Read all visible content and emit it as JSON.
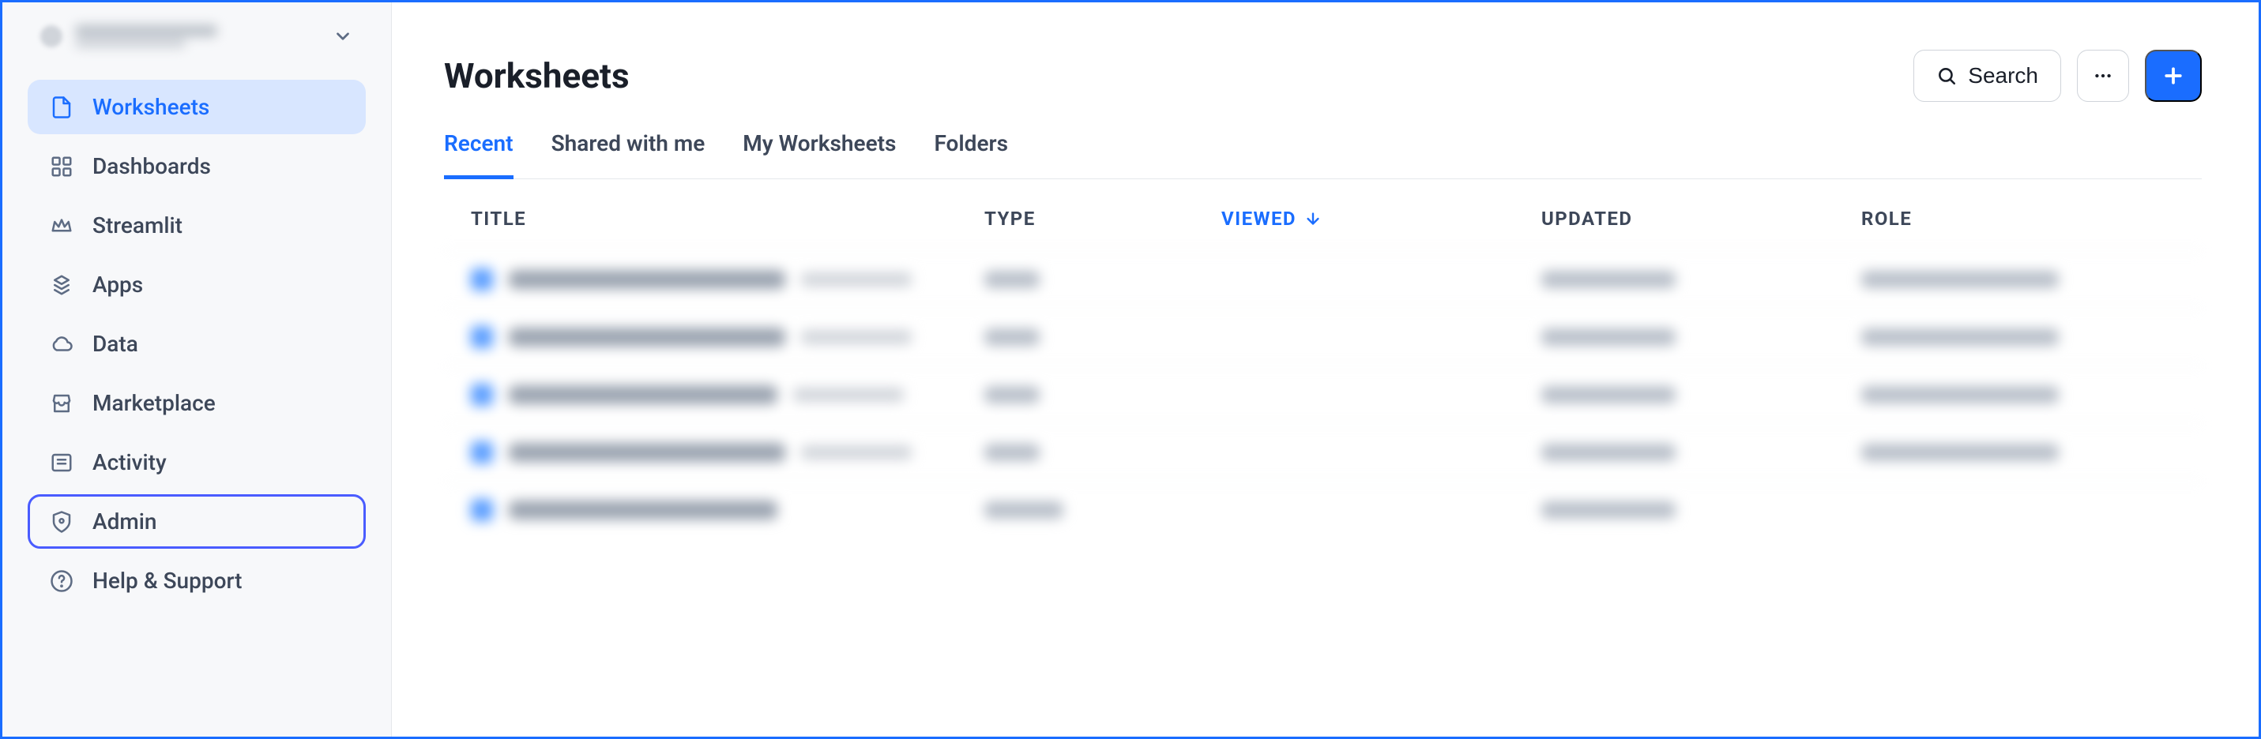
{
  "sidebar": {
    "nav": [
      {
        "label": "Worksheets",
        "icon": "document"
      },
      {
        "label": "Dashboards",
        "icon": "grid"
      },
      {
        "label": "Streamlit",
        "icon": "crown"
      },
      {
        "label": "Apps",
        "icon": "apps"
      },
      {
        "label": "Data",
        "icon": "cloud"
      },
      {
        "label": "Marketplace",
        "icon": "storefront"
      },
      {
        "label": "Activity",
        "icon": "activity"
      },
      {
        "label": "Admin",
        "icon": "shield"
      },
      {
        "label": "Help & Support",
        "icon": "help"
      }
    ]
  },
  "header": {
    "title": "Worksheets",
    "search_label": "Search"
  },
  "tabs": [
    {
      "label": "Recent",
      "active": true
    },
    {
      "label": "Shared with me",
      "active": false
    },
    {
      "label": "My Worksheets",
      "active": false
    },
    {
      "label": "Folders",
      "active": false
    }
  ],
  "columns": {
    "title": "TITLE",
    "type": "TYPE",
    "viewed": "VIEWED",
    "updated": "UPDATED",
    "role": "ROLE"
  },
  "rows_count": 5
}
